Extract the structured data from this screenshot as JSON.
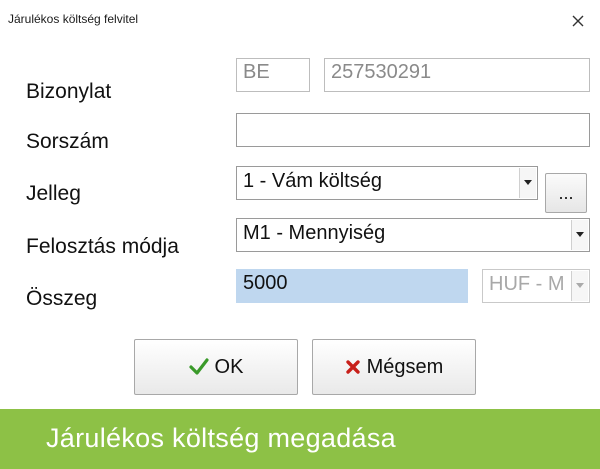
{
  "window": {
    "title": "Járulékos költség felvitel",
    "close_icon": "close-icon"
  },
  "form": {
    "bizonylat": {
      "label": "Bizonylat",
      "prefix": "BE",
      "number": "257530291"
    },
    "sorszam": {
      "label": "Sorszám",
      "value": ""
    },
    "jelleg": {
      "label": "Jelleg",
      "selected": "1 - Vám költség",
      "browse_label": "..."
    },
    "felosztas": {
      "label": "Felosztás módja",
      "selected": "M1 - Mennyiség"
    },
    "osszeg": {
      "label": "Összeg",
      "value": "5000",
      "currency": "HUF - M"
    }
  },
  "buttons": {
    "ok_label": "OK",
    "cancel_label": "Mégsem",
    "ok_icon": "checkmark-icon",
    "cancel_icon": "x-mark-icon"
  },
  "footer": {
    "caption": "Járulékos költség megadása",
    "color": "#8dc146"
  },
  "colors": {
    "highlight": "#bfd7ef",
    "ok_green": "#3a9a2a",
    "cancel_red": "#c8201a"
  }
}
